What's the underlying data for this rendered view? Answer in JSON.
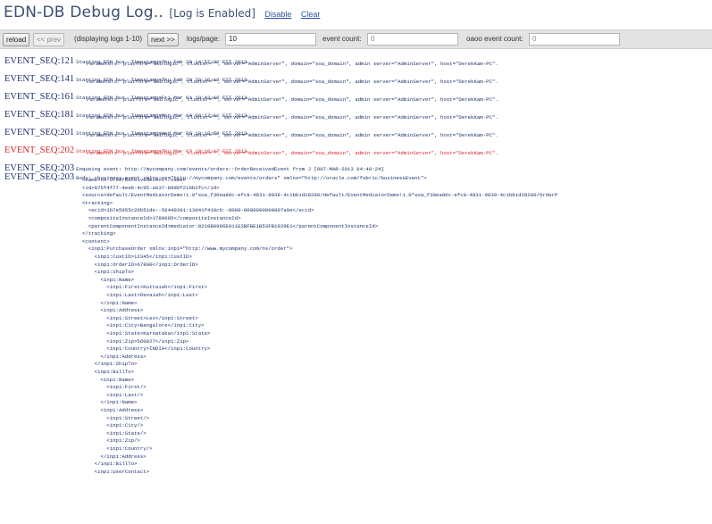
{
  "header": {
    "title": "EDN-DB Debug Log",
    "dots": "..",
    "status": "[Log is Enabled]",
    "disable_link": "Disable",
    "clear_link": "Clear"
  },
  "toolbar": {
    "reload": "reload",
    "prev": "<< prev",
    "displaying": "(displaying logs 1-10)",
    "next": "next >>",
    "logs_per_page_label": "logs/page:",
    "logs_per_page_value": "10",
    "event_count_label": "event count:",
    "event_count_value": "0",
    "oaoo_label": "oaoo event count:",
    "oaoo_value": "0"
  },
  "log": {
    "entries": [
      {
        "seq": "EVENT_SEQ:121",
        "line1": "Starting EDN bus. Timestamp=Thu Feb 28 14:57:32 EST 2013.",
        "line2": "Parameters: platform=\"weblogic\", cluster=\"\", server=\"AdminServer\", domain=\"soa_domain\", admin server=\"AdminServer\", host=\"DerekKam-PC\".",
        "error": false
      },
      {
        "seq": "EVENT_SEQ:141",
        "line1": "Starting EDN bus. Timestamp=Thu Feb 28 20:36:13 EST 2013.",
        "line2": "Parameters: platform=\"weblogic\", cluster=\"\", server=\"AdminServer\", domain=\"soa_domain\", admin server=\"AdminServer\", host=\"DerekKam-PC\".",
        "error": false
      },
      {
        "seq": "EVENT_SEQ:161",
        "line1": "Starting EDN bus. Timestamp=Fri Mar 01 10:43:16 EST 2013.",
        "line2": "Parameters: platform=\"weblogic\", cluster=\"\", server=\"AdminServer\", domain=\"soa_domain\", admin server=\"AdminServer\", host=\"DerekKam-PC\".",
        "error": false
      },
      {
        "seq": "EVENT_SEQ:181",
        "line1": "Starting EDN bus. Timestamp=Mon Mar 04 08:17:11 EST 2013.",
        "line2": "Parameters: platform=\"weblogic\", cluster=\"\", server=\"AdminServer\", domain=\"soa_domain\", admin server=\"AdminServer\", host=\"DerekKam-PC\".",
        "error": false
      },
      {
        "seq": "EVENT_SEQ:201",
        "line1": "Starting EDN bus. Timestamp=Wed Mar 06 18:18:59 EST 2013.",
        "line2": "Parameters: platform=\"weblogic\", cluster=\"\", server=\"AdminServer\", domain=\"soa_domain\", admin server=\"AdminServer\", host=\"DerekKam-PC\".",
        "error": false
      },
      {
        "seq": "EVENT_SEQ:202",
        "line1": "Starting EDN bus. Timestamp=Thu Mar 07 10:10:17 EST 2013.",
        "line2": "Parameters: platform=\"weblogic\", cluster=\"\", server=\"AdminServer\", domain=\"soa_domain\", admin server=\"AdminServer\", host=\"DerekKam-PC\".",
        "error": true
      },
      {
        "seq": "EVENT_SEQ:203",
        "line1": "Enqueing event: http://mycompany.com/events/orders::OrderReceivedEvent from J [807-MAR-2013 04:40:24]",
        "line2": "",
        "error": false
      },
      {
        "seq": "EVENT_SEQ:203",
        "line1": "Body: <business-event xmlns:ns=\"http://mycompany.com/events/orders\" xmlns=\"http://oracle.com/fabric/businessEvent\">",
        "line2": "",
        "error": false
      }
    ],
    "body_lines": [
      "<name>ns:OrderReceivedEvent</name>",
      "<id>875f4f77-4eeb-4c95-a637-89d0f21bb2fc</id>",
      "<source>default/EventMediatorDemo!1.0*soa_f30ea80c-efc8-4831-9939-4c1bb1d28280/default/EventMediatorDemo!1.0*soa_f30ea80c-efc8-4831-9939-4c1bb1d28280/OrderP",
      "<tracking>",
      "  <ecid>1b7e5955c26b51de:-56440391:13d41f410c6:-8000-0000000000007a9e</ecid>",
      "  <compositeInstanceId>1780005</compositeInstanceId>",
      "  <parentComponentInstanceId>mediator:8210B0986E911E2BFBE1B53FB1929E1</parentComponentInstanceId>",
      "</tracking>",
      "<content>",
      "  <inp1:PurchaseOrder xmlns:inp1=\"http://www.mycompany.com/ns/order\">",
      "    <inp1:CustID>12345</inp1:CustID>",
      "    <inp1:OrderID>67890</inp1:OrderID>",
      "    <inp1:ShipTo>",
      "      <inp1:Name>",
      "        <inp1:First>Kuttaiah</inp1:First>",
      "        <inp1:Last>Devaiah</inp1:Last>",
      "      </inp1:Name>",
      "      <inp1:Address>",
      "        <inp1:Street>Lex</inp1:Street>",
      "        <inp1:City>Bangalore</inp1:City>",
      "        <inp1:State>Karnataka</inp1:State>",
      "        <inp1:Zip>560027</inp1:Zip>",
      "        <inp1:Country>INDIA</inp1:Country>",
      "      </inp1:Address>",
      "    </inp1:ShipTo>",
      "    <inp1:BillTo>",
      "      <inp1:Name>",
      "        <inp1:First/>",
      "        <inp1:Last/>",
      "      </inp1:Name>",
      "      <inp1:Address>",
      "        <inp1:Street/>",
      "        <inp1:City/>",
      "        <inp1:State/>",
      "        <inp1:Zip/>",
      "        <inp1:Country/>",
      "      </inp1:Address>",
      "    </inp1:BillTo>",
      "    <inp1:UserContact>"
    ]
  }
}
